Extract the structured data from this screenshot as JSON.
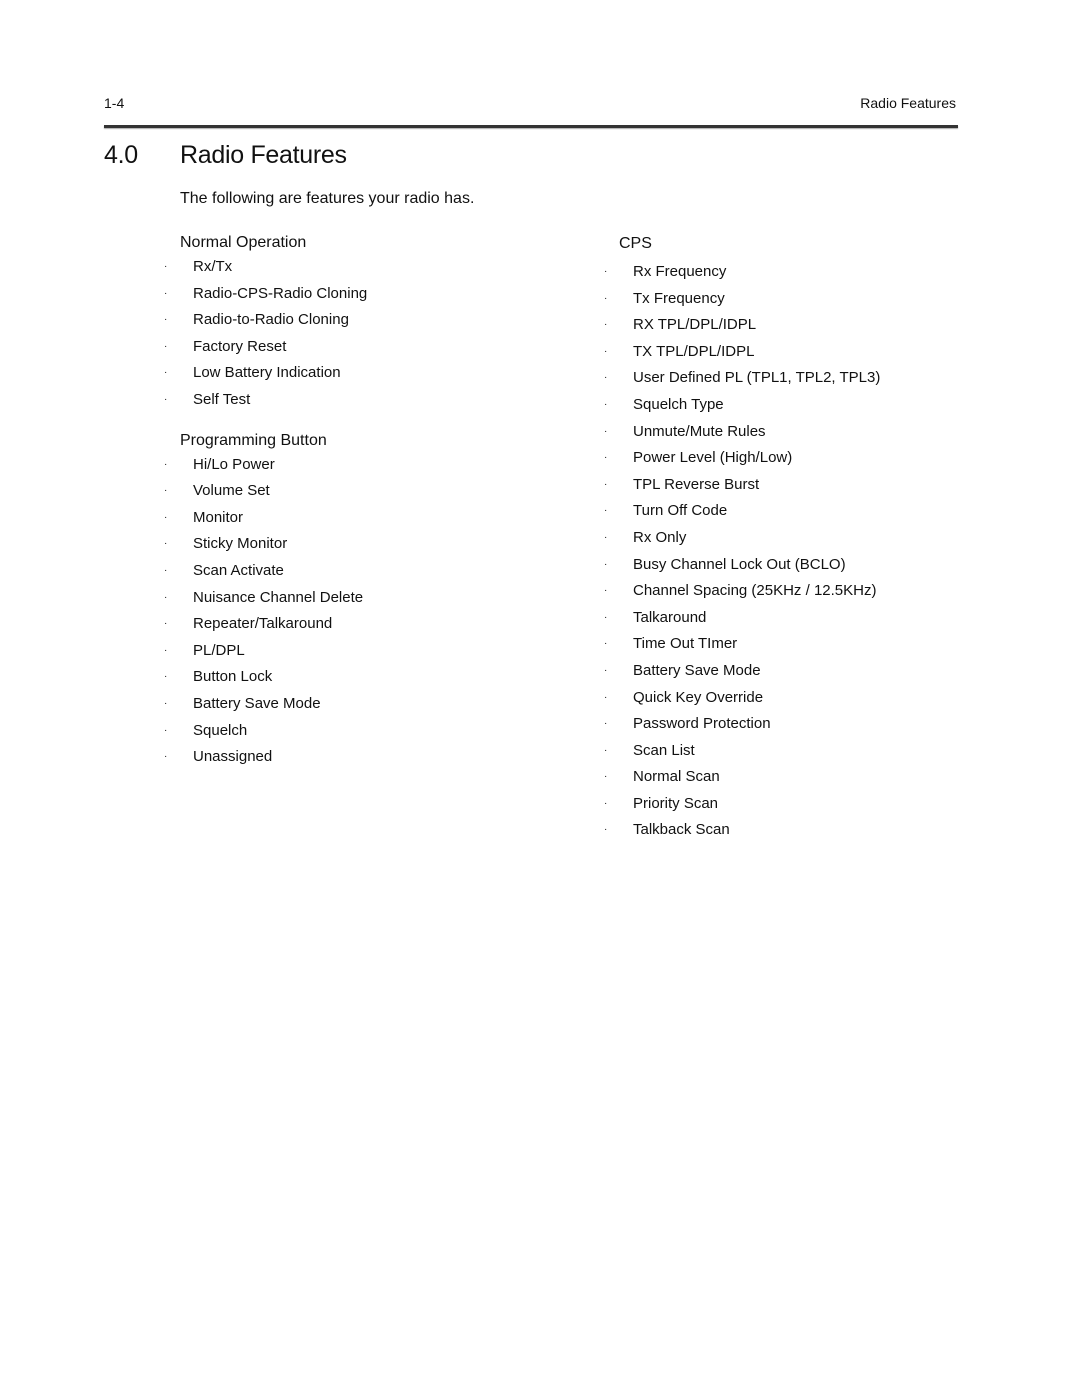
{
  "header": {
    "page_number": "1-4",
    "running_title": "Radio Features"
  },
  "section": {
    "number": "4.0",
    "title": "Radio Features",
    "intro": "The following are features your radio has."
  },
  "bullet_glyph": "·",
  "groups": {
    "normal_operation": {
      "title": "Normal Operation",
      "items": [
        "Rx/Tx",
        "Radio-CPS-Radio Cloning",
        "Radio-to-Radio Cloning",
        "Factory Reset",
        "Low Battery Indication",
        "Self Test"
      ]
    },
    "programming_button": {
      "title": "Programming Button",
      "items": [
        "Hi/Lo Power",
        "Volume Set",
        "Monitor",
        "Sticky Monitor",
        "Scan Activate",
        "Nuisance Channel Delete",
        "Repeater/Talkaround",
        "PL/DPL",
        "Button Lock",
        "Battery Save Mode",
        "Squelch",
        "Unassigned"
      ]
    },
    "cps": {
      "title": "CPS",
      "items": [
        "Rx Frequency",
        "Tx Frequency",
        "RX TPL/DPL/IDPL",
        "TX TPL/DPL/IDPL",
        "User Defined PL (TPL1, TPL2, TPL3)",
        "Squelch Type",
        "Unmute/Mute Rules",
        "Power Level (High/Low)",
        "TPL Reverse Burst",
        "Turn Off Code",
        "Rx Only",
        "Busy Channel Lock Out (BCLO)",
        "Channel Spacing (25KHz / 12.5KHz)",
        "Talkaround",
        "Time Out TImer",
        "Battery Save Mode",
        "Quick Key Override",
        "Password Protection",
        "Scan List",
        "Normal Scan",
        "Priority Scan",
        "Talkback Scan"
      ]
    }
  }
}
